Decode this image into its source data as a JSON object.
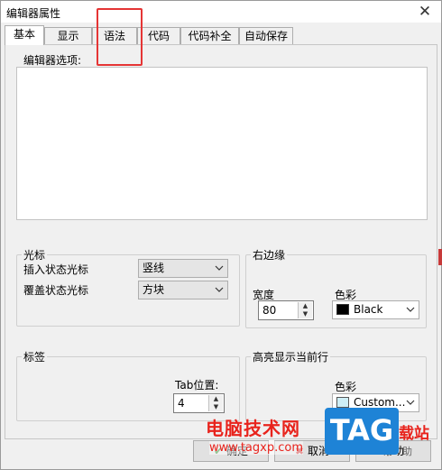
{
  "window": {
    "title": "编辑器属性",
    "close_symbol": "✕"
  },
  "tabs": [
    {
      "label": "基本",
      "active": true
    },
    {
      "label": "显示",
      "active": false
    },
    {
      "label": "语法",
      "active": false
    },
    {
      "label": "代码",
      "active": false
    },
    {
      "label": "代码补全",
      "active": false
    },
    {
      "label": "自动保存",
      "active": false
    }
  ],
  "editor_options": {
    "label": "编辑器选项:"
  },
  "cursor": {
    "title": "光标",
    "insert_label": "插入状态光标",
    "insert_value": "竖线",
    "overwrite_label": "覆盖状态光标",
    "overwrite_value": "方块"
  },
  "right_margin": {
    "title": "右边缘",
    "width_label": "宽度",
    "width_value": "80",
    "color_label": "色彩",
    "color_value": "Black",
    "color_hex": "#000000"
  },
  "tags": {
    "title": "标签",
    "tab_label": "Tab位置:",
    "tab_value": "4"
  },
  "highlight_line": {
    "title": "高亮显示当前行",
    "color_label": "色彩",
    "color_value": "Custom...",
    "color_hex": "#cdeef6"
  },
  "buttons": {
    "ok": "确定",
    "cancel": "取消",
    "help": "帮助"
  },
  "watermark": {
    "text": "电脑技术网",
    "url": "www.tagxp.com",
    "logo": "TAG",
    "tail": "载站",
    "tail2": "助"
  },
  "colors": {
    "annotation": "#e53535",
    "watermark_red": "#e8231c",
    "logo_blue": "#1e83d6"
  }
}
